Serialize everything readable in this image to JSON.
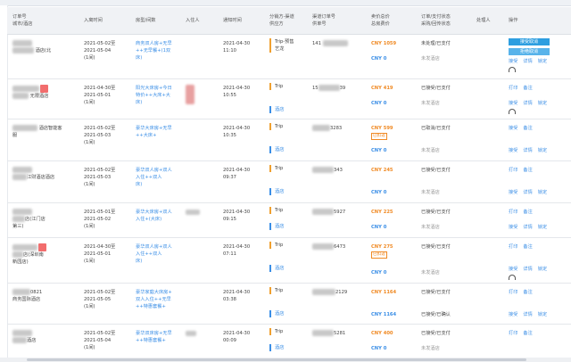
{
  "headers": {
    "order_city": "订单号\n城市/酒店",
    "checkin": "入离时间",
    "room_type": "房型/间数",
    "guest": "入住人",
    "notify_time": "通知时间",
    "channel": "分销方-渠道\n供应方",
    "channel_order": "渠道订单号\n供单号",
    "price": "卖价总价\n总房费价",
    "status": "订单/支付状态\n采购/回传状态",
    "handler": "处理人",
    "ops": "操作"
  },
  "rows": [
    {
      "hotel_suffix": "酒店(北",
      "dates": "2021-05-02至\n2021-05-04",
      "nights": "(1间)",
      "room": "商务双人房+无早\n++无早餐+(1双\n床)",
      "notify": "2021-04-30\n11:10",
      "channel": "Trip-预售\n艺龙",
      "channel2": "",
      "order_prefix": "141",
      "price1": "CNY 1059",
      "price_tag": "",
      "price2": "CNY 0",
      "status1": "未处理/已支付",
      "status2": "未发酒店",
      "ops_primary": "接受取消",
      "ops_secondary": "拒绝取消",
      "links": [
        "接受",
        "详情",
        "锁定"
      ]
    },
    {
      "hotel_suffix": "无限酒店",
      "dates": "2021-04-30至\n2021-05-01",
      "nights": "(1间)",
      "room": "阳光大床房+今日\n特价++大床+大\n床)",
      "notify": "2021-04-30\n10:55",
      "channel": "Trip",
      "channel2": "酒店",
      "order_prefix": "15",
      "order_suffix": "39",
      "price1": "CNY 419",
      "price_tag": "",
      "price2": "CNY 0",
      "status1": "已接受/已支付",
      "status2": "未发酒店",
      "links": [
        "打印",
        "备注"
      ],
      "links2": [
        "接受",
        "详情",
        "锁定"
      ]
    },
    {
      "hotel_suffix": "酒店智能客\n服",
      "dates": "2021-05-02至\n2021-05-03",
      "nights": "(1间)",
      "room": "豪华大床房+无早\n++大床+",
      "notify": "2021-04-30\n10:35",
      "channel": "Trip",
      "channel2": "酒店",
      "order_suffix": "3283",
      "price1": "CNY 599",
      "price_tag": "已扣返",
      "price2": "CNY 0",
      "status1": "已取消/已支付",
      "status2": "未发酒店",
      "links": [
        "接受",
        "备注"
      ],
      "links2": [
        "接受",
        "详情",
        "锁定"
      ]
    },
    {
      "hotel_suffix": "江财酒店酒店",
      "dates": "2021-05-02至\n2021-05-03",
      "nights": "(1间)",
      "room": "豪华双人房+双人\n入住++双人\n床)",
      "notify": "2021-04-30\n09:37",
      "channel": "Trip",
      "channel2": "酒店",
      "order_suffix": "343",
      "price1": "CNY 245",
      "price_tag": "",
      "price2": "CNY 0",
      "status1": "已接受/已支付",
      "status2": "未发酒店",
      "links": [
        "打印",
        "备注"
      ],
      "links2": [
        "接受",
        "详情",
        "锁定"
      ]
    },
    {
      "hotel_suffix": "店(江门店\n第三)",
      "dates": "2021-05-01至\n2021-05-02",
      "nights": "(1间)",
      "room": "豪华大床房+双人\n入住+(大床)",
      "notify": "2021-04-30\n09:15",
      "channel": "Trip",
      "channel2": "酒店",
      "order_suffix": "5927",
      "price1": "CNY 225",
      "price_tag": "",
      "price2": "CNY 0",
      "status1": "已接受/已支付",
      "status2": "未发酒店",
      "links": [
        "打印",
        "备注"
      ],
      "links2": [
        "接受",
        "详情",
        "锁定"
      ]
    },
    {
      "hotel_suffix": "店(深圳南\n新园店)",
      "dates": "2021-04-30至\n2021-05-01",
      "nights": "(1间)",
      "room": "豪华双人房+双人\n入住++双人\n床)",
      "notify": "2021-04-30\n07:11",
      "channel": "Trip",
      "channel2": "酒店",
      "order_suffix": "6473",
      "price1": "CNY 275",
      "price_tag": "已扣返",
      "price2": "CNY 0",
      "status1": "已接受/已支付",
      "status2": "未发酒店",
      "links": [
        "打印",
        "备注"
      ],
      "links2": [
        "接受",
        "详情",
        "锁定"
      ]
    },
    {
      "hotel_suffix": "0821\n商务国际酒店",
      "dates": "2021-05-02至\n2021-05-05",
      "nights": "(1间)",
      "room": "豪华家庭大床房+\n双人入住++无早\n++特惠套餐+",
      "notify": "2021-04-30\n03:38",
      "channel": "Trip",
      "channel2": "酒店",
      "order_suffix": "2129",
      "price1": "CNY 1164",
      "price_tag": "",
      "price2": "CNY 1164",
      "status1": "已接受/已支付",
      "status2": "已接受/已确认",
      "links": [
        "打印",
        "备注"
      ],
      "links2": [
        "接受",
        "详情",
        "锁定"
      ]
    },
    {
      "hotel_suffix": "酒店",
      "dates": "2021-05-02至\n2021-05-04",
      "nights": "(1间)",
      "room": "豪华双床房+无早\n++特惠套餐+",
      "notify": "2021-04-30\n00:09",
      "channel": "Trip",
      "channel2": "酒店",
      "order_suffix": "5281",
      "price1": "CNY 400",
      "price_tag": "",
      "price2": "CNY 0",
      "status1": "已接受/已支付",
      "status2": "未发酒店",
      "links": [
        "打印",
        "备注"
      ],
      "links2": []
    }
  ]
}
